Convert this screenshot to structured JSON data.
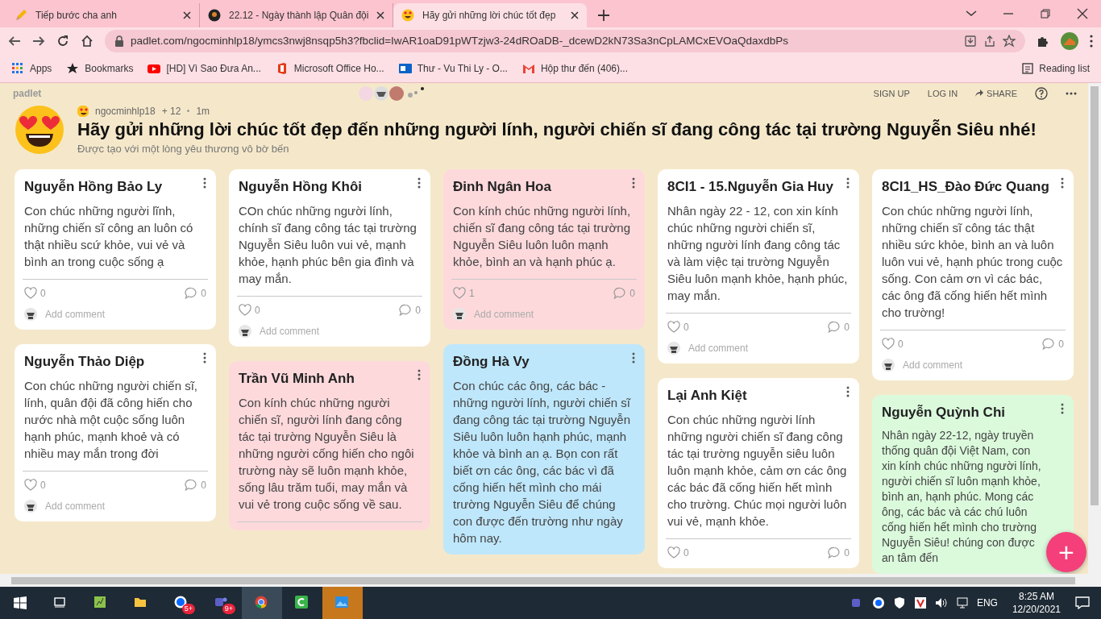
{
  "browser": {
    "tabs": [
      {
        "title": "Tiếp bước cha anh",
        "kind": "pencil",
        "selected": false
      },
      {
        "title": "22.12 - Ngày thành lập Quân đội",
        "kind": "dark",
        "selected": false
      },
      {
        "title": "Hãy gửi những lời chúc tốt đẹp",
        "kind": "emoji",
        "selected": true
      }
    ],
    "url": "padlet.com/ngocminhlp18/ymcs3nwj8nsqp5h3?fbclid=IwAR1oaD91pWTzjw3-24dROaDB-_dcewD2kN73Sa3nCpLAMCxEVOaQdaxdbPs",
    "bookmarks": [
      {
        "label": "Apps",
        "kind": "grid"
      },
      {
        "label": "Bookmarks",
        "kind": "star"
      },
      {
        "label": "[HD] Vì Sao Đưa An...",
        "kind": "video"
      },
      {
        "label": "Microsoft Office Ho...",
        "kind": "office"
      },
      {
        "label": "Thư - Vu Thi Ly - O...",
        "kind": "mail"
      },
      {
        "label": "Hộp thư đến (406)...",
        "kind": "gmail"
      }
    ],
    "reading_list": "Reading list"
  },
  "header": {
    "logo": "padlet",
    "actions": [
      "SIGN UP",
      "LOG IN",
      "SHARE"
    ]
  },
  "board": {
    "author": "ngocminhlp18",
    "plus": "+ 12",
    "time": "1m",
    "title": "Hãy gửi những lời chúc tốt đẹp đến những người lính, người chiến sĩ đang công tác tại trường Nguyễn Siêu nhé!",
    "subtitle": "Được tạo với một lòng yêu thương vô bờ bến"
  },
  "columns": [
    [
      {
        "title": "Nguyễn Hồng Bảo Ly",
        "color": "#ffffff",
        "body": "Con chúc những người lĩnh, những chiến sĩ công an luôn có thật nhiều scứ khỏe, vui vẻ và bình an trong cuộc sống ạ",
        "divider": true,
        "likes": "0",
        "comments": "0",
        "add_comment": "Add comment"
      },
      {
        "title": "Nguyễn Thảo Diệp",
        "color": "#ffffff",
        "body": "Con chúc những người chiến sĩ, lính, quân đội đã công hiến cho nước nhà một cuộc sống luôn hạnh phúc, mạnh khoẻ và có nhiều may mắn trong đời",
        "divider": true,
        "likes": "0",
        "comments": "0",
        "add_comment": "Add comment"
      }
    ],
    [
      {
        "title": "Nguyễn Hồng Khôi",
        "color": "#ffffff",
        "body": "COn chúc những người lính, chính sĩ đang công tác tại trường Nguyễn Siêu luôn vui vẻ, mạnh khỏe, hạnh phúc bên gia đình và may mắn.",
        "divider": true,
        "likes": "0",
        "comments": "0",
        "add_comment": "Add comment"
      },
      {
        "title": "Trần Vũ Minh Anh",
        "color": "#fdd9dc",
        "body": "Con kính chúc những người chiến sĩ, người lính đang công tác tại trường Nguyễn Siêu là những người cống hiến cho ngôi trường này sẽ luôn mạnh khỏe, sống lâu trăm tuổi, may mắn và vui vẻ trong cuộc sống về sau.",
        "divider": true
      }
    ],
    [
      {
        "title": "Đinh Ngân Hoa",
        "color": "#fdd9dc",
        "body": "Con kính chúc những người lính, chiến sĩ đang công tác tại trường Nguyễn Siêu luôn luôn mạnh khỏe, bình an và hạnh phúc ạ.",
        "divider": true,
        "likes": "1",
        "comments": "0",
        "add_comment": "Add comment"
      },
      {
        "title": "Đồng Hà Vy",
        "color": "#bfe7fb",
        "body": "Con chúc các ông, các bác - những người lính, người chiến sĩ đang công tác tại trường Nguyễn Siêu luôn luôn hạnh phúc, mạnh khỏe và bình an ạ. Bọn con rất biết ơn các ông, các bác vì đã cống hiến hết mình cho mái trường Nguyễn Siêu để chúng con được đến trường như ngày hôm nay.",
        "divider": false
      }
    ],
    [
      {
        "title": "8CI1 - 15.Nguyễn Gia Huy",
        "color": "#ffffff",
        "body": "Nhân ngày 22 - 12, con xin kính chúc những người chiến sĩ, những người lính đang công tác và làm việc tại trường Nguyễn Siêu luôn mạnh khỏe, hạnh phúc, may mắn.",
        "divider": true,
        "likes": "0",
        "comments": "0",
        "add_comment": "Add comment"
      },
      {
        "title": "Lại Anh Kiệt",
        "color": "#ffffff",
        "body": "Con chúc những người lính những người chiến sĩ đang công tác tại trường nguyễn siêu luôn luôn mạnh khỏe, cảm ơn các ông các bác đã cống hiến hết mình cho trường. Chúc mọi người luôn vui vẻ, mạnh khỏe.",
        "divider": true,
        "likes": "0",
        "comments": "0"
      }
    ],
    [
      {
        "title": "8CI1_HS_Đào Đức Quang",
        "color": "#ffffff",
        "body": "Con chúc những người lính, những chiến sĩ công tác thật nhiều sức khỏe, bình an và luôn luôn vui vẻ, hạnh phúc trong cuộc sống. Con cảm ơn vì các bác, các ông đã cống hiến hết mình cho trường!",
        "divider": true,
        "likes": "0",
        "comments": "0",
        "add_comment": "Add comment"
      },
      {
        "title": "Nguyễn Quỳnh Chi",
        "color": "#dbfadc",
        "body": "Nhân ngày 22-12, ngày truyền thống quân đội Việt Nam, con xin kính chúc những người lính, người chiến sĩ luôn mạnh khỏe, bình an, hạnh phúc. Mong các ông, các bác và các chú luôn cống hiến hết mình cho trường Nguyễn Siêu! chúng con được an tâm đến",
        "divider": false
      }
    ]
  ],
  "fab": "+",
  "taskbar": {
    "apps": [
      {
        "kind": "taskview",
        "active": false
      },
      {
        "kind": "notes",
        "active": false
      },
      {
        "kind": "folder",
        "active": false
      },
      {
        "kind": "zalo",
        "badge": "5+",
        "active": false
      },
      {
        "kind": "teams",
        "badge": "9+",
        "active": false
      },
      {
        "kind": "chrome",
        "active": true
      },
      {
        "kind": "camtasia",
        "active": false
      },
      {
        "kind": "photos",
        "active": true
      }
    ],
    "language": "ENG",
    "time": "8:25 AM",
    "date": "12/20/2021"
  }
}
